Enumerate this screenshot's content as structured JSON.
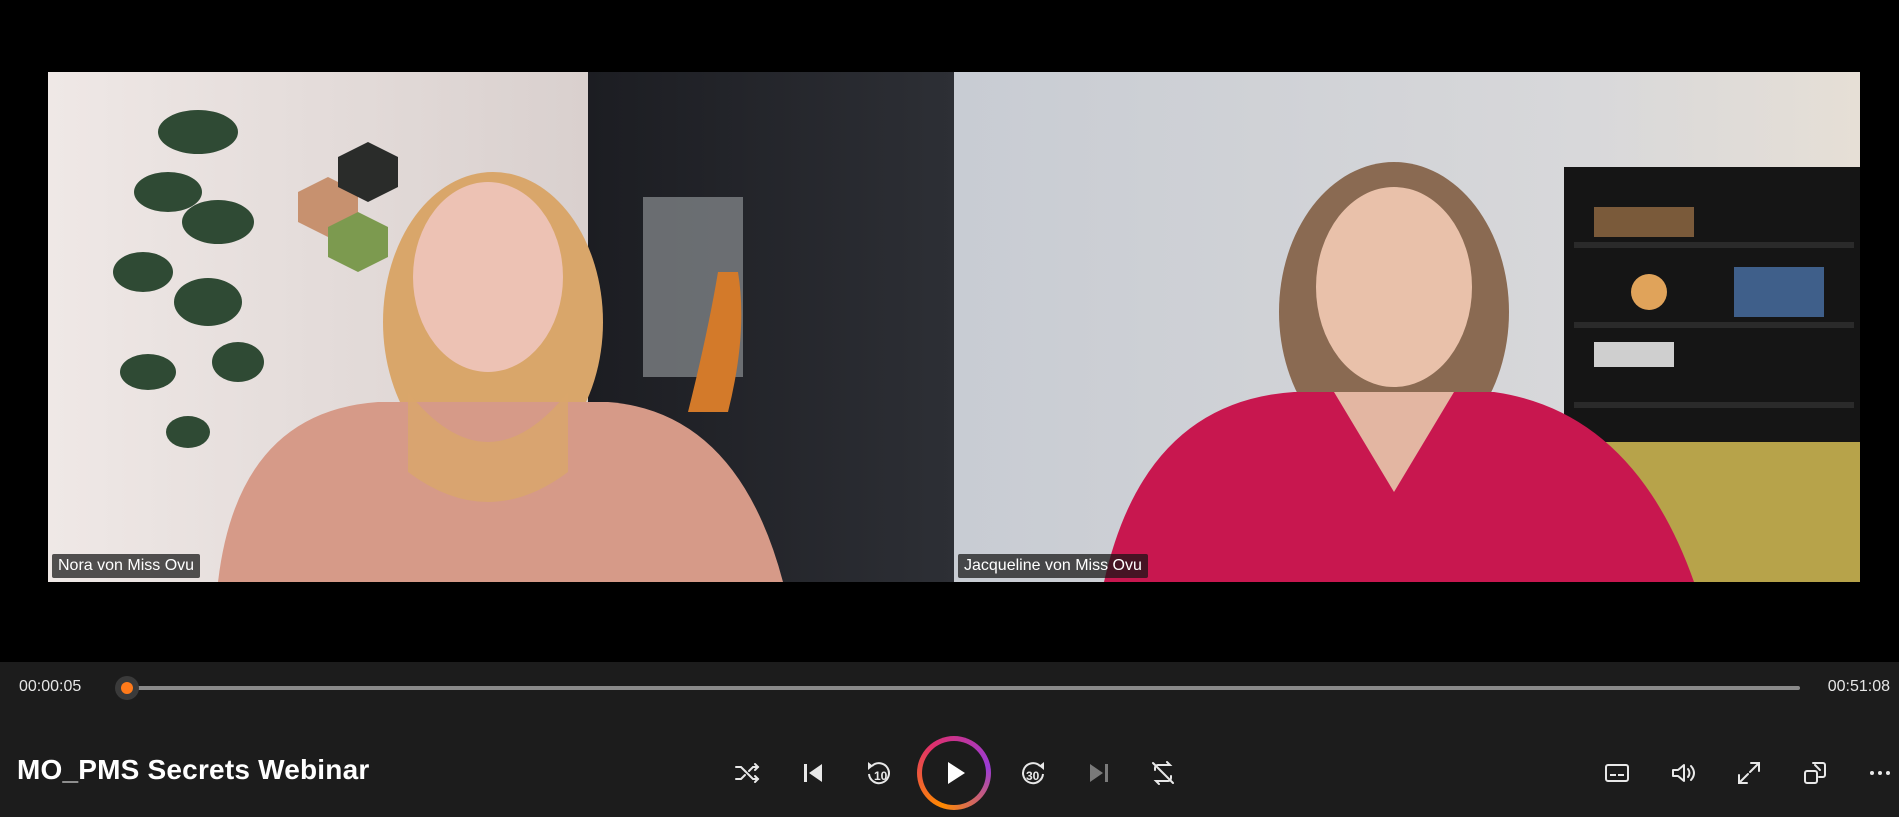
{
  "player": {
    "title": "MO_PMS Secrets Webinar",
    "time_current": "00:00:05",
    "time_total": "00:51:08",
    "progress_fraction": 0.0016,
    "accent_color": "#ff7a1a"
  },
  "participants": [
    {
      "name": "Nora von Miss Ovu"
    },
    {
      "name": "Jacqueline von Miss Ovu"
    }
  ],
  "buttons": {
    "shuffle": "shuffle-icon",
    "previous": "skip-previous-icon",
    "rewind": "rewind-10-icon",
    "rewind_label": "10",
    "play": "play-icon",
    "forward": "forward-30-icon",
    "forward_label": "30",
    "next": "skip-next-icon",
    "repeat": "repeat-off-icon",
    "captions": "captions-icon",
    "volume": "volume-icon",
    "fullscreen": "fullscreen-icon",
    "miniplayer": "miniplayer-icon",
    "more": "more-options-icon"
  }
}
